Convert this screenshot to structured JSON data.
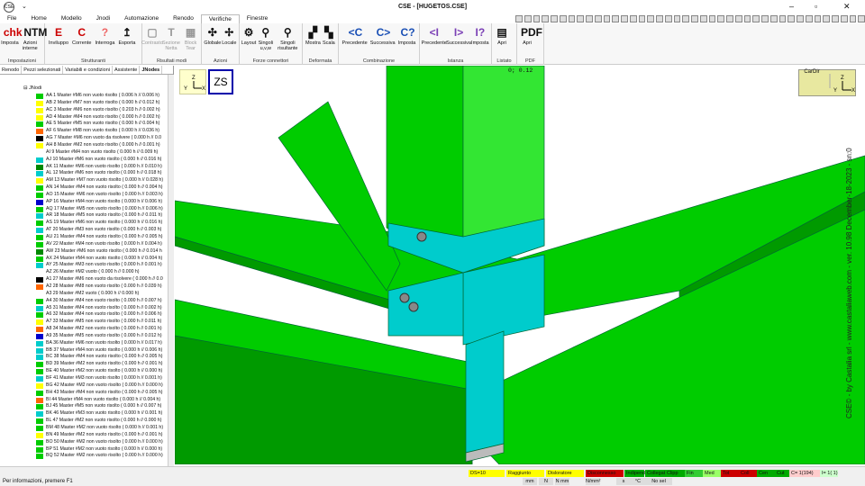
{
  "title": "CSE - [HUGETOS.CSE]",
  "quick_access_label": "⌄",
  "menu": {
    "tabs": [
      "File",
      "Home",
      "Modello",
      "Jnodi",
      "Automazione",
      "Renodo",
      "Verifiche",
      "Finestre"
    ],
    "active": "Verifiche"
  },
  "ribbon": {
    "groups": [
      {
        "label": "Impostazioni",
        "buttons": [
          {
            "label": "Imposta",
            "icon": "chk"
          },
          {
            "label": "Azioni\ninterne",
            "icon": "NTM"
          }
        ]
      },
      {
        "label": "Strutturanti",
        "buttons": [
          {
            "label": "Inviluppo",
            "icon": "E"
          },
          {
            "label": "Corrente",
            "icon": "C"
          },
          {
            "label": "Interroga",
            "icon": "?"
          },
          {
            "label": "Esporta",
            "icon": "↥"
          }
        ]
      },
      {
        "label": "Risultati modi",
        "buttons": [
          {
            "label": "Contrasto",
            "icon": "▢"
          },
          {
            "label": "Sezione\nNetta",
            "icon": "T"
          },
          {
            "label": "Block\nTear",
            "icon": "▦"
          }
        ]
      },
      {
        "label": "Azioni",
        "buttons": [
          {
            "label": "Globale",
            "icon": "✣"
          },
          {
            "label": "Locale",
            "icon": "✢"
          }
        ]
      },
      {
        "label": "Forze connettori",
        "buttons": [
          {
            "label": "Layout",
            "icon": "⚙"
          },
          {
            "label": "Singoli\nu,v,w",
            "icon": "⚲"
          },
          {
            "label": "Singoli\nrisultante",
            "icon": "⚲"
          }
        ]
      },
      {
        "label": "Deformata",
        "buttons": [
          {
            "label": "Mostra",
            "icon": "▞"
          },
          {
            "label": "Scala",
            "icon": "▚"
          }
        ]
      },
      {
        "label": "Combinazione",
        "buttons": [
          {
            "label": "Precedente",
            "icon": "<C"
          },
          {
            "label": "Successiva",
            "icon": "C>"
          },
          {
            "label": "Imposta",
            "icon": "C?"
          }
        ]
      },
      {
        "label": "Istanza",
        "buttons": [
          {
            "label": "Precedente",
            "icon": "<I"
          },
          {
            "label": "Successiva",
            "icon": "I>"
          },
          {
            "label": "Imposta",
            "icon": "I?"
          }
        ]
      },
      {
        "label": "Listato",
        "buttons": [
          {
            "label": "Apri",
            "icon": "▤"
          }
        ]
      },
      {
        "label": "PDF",
        "buttons": [
          {
            "label": "Apri",
            "icon": "PDF"
          }
        ]
      }
    ]
  },
  "panel": {
    "tabs": [
      "Renodo",
      "Pezzi selezionati",
      "Variabili e condizioni",
      "Assistente",
      "JNodes"
    ],
    "active_tab": "JNodes",
    "root": "JNodi",
    "rows": [
      {
        "text": "AA 1  Master  #M6 non vuoto risolto ( 0.006 h //  0.006 h)",
        "color": "#00cc00"
      },
      {
        "text": "AB 2  Master  #M7 non vuoto risolto ( 0.000 h //  0.012 h)",
        "color": "#ffff00"
      },
      {
        "text": "AC 3  Master  #M6 non vuoto risolto ( 0.203 h //  0.002 h)",
        "color": "#ffff00"
      },
      {
        "text": "AD 4  Master  #M4 non vuoto risolto ( 0.000 h //  0.002 h)",
        "color": "#ffff00"
      },
      {
        "text": "AE 5  Master  #M5 non vuoto risolto ( 0.000 h //  0.004 h)",
        "color": "#00cc00"
      },
      {
        "text": "AF 6  Master  #M8 non vuoto risolto ( 0.000 h //  0.036 h)",
        "color": "#ff6600"
      },
      {
        "text": "AG 7  Master  #M6 non vuoto da risolvere ( 0.000 h //  0.0",
        "color": "#000000"
      },
      {
        "text": "AH 8  Master  #M2 non vuoto risolto ( 0.000 h //  0.001 h)",
        "color": "#ffff00"
      },
      {
        "text": "AI 9  Master  #M4 non vuoto risolto ( 0.000 h //  0.009 h)",
        "color": "#ffffff"
      },
      {
        "text": "AJ 10  Master  #M6 non vuoto risolto ( 0.000 h //  0.016 h)",
        "color": "#00cccc"
      },
      {
        "text": "AK 11  Master  #M6 non vuoto risolto ( 0.000 h //  0.010 h)",
        "color": "#008800"
      },
      {
        "text": "AL 12  Master  #M6 non vuoto risolto ( 0.000 h //  0.018 h)",
        "color": "#00cccc"
      },
      {
        "text": "AM 13  Master  #M7 non vuoto risolto ( 0.000 h //  0.028 h)",
        "color": "#ffff00"
      },
      {
        "text": "AN 14  Master  #M4 non vuoto risolto ( 0.000 h //  0.004 h)",
        "color": "#00cc00"
      },
      {
        "text": "AO 15  Master  #M6 non vuoto risolto ( 0.000 h //  0.003 h)",
        "color": "#00cc00"
      },
      {
        "text": "AP 16  Master  #M4 non vuoto risolto ( 0.000 h //  0.006 h)",
        "color": "#0000cc"
      },
      {
        "text": "AQ 17  Master  #M5 non vuoto risolto ( 0.000 h //  0.006 h)",
        "color": "#00cc00"
      },
      {
        "text": "AR 18  Master  #M5 non vuoto risolto ( 0.000 h //  0.011 h)",
        "color": "#00cccc"
      },
      {
        "text": "AS 19  Master  #M6 non vuoto risolto ( 0.000 h //  0.016 h)",
        "color": "#00cc00"
      },
      {
        "text": "AT 20  Master  #M3 non vuoto risolto ( 0.000 h //  0.003 h)",
        "color": "#00cccc"
      },
      {
        "text": "AU 21  Master  #M4 non vuoto risolto ( 0.000 h //  0.005 h)",
        "color": "#00cc00"
      },
      {
        "text": "AV 22  Master  #M4 non vuoto risolto ( 0.000 h //  0.004 h)",
        "color": "#00cc00"
      },
      {
        "text": "AW 23  Master  #M6 non vuoto risolto ( 0.000 h //  0.014 h",
        "color": "#008800"
      },
      {
        "text": "AX 24  Master  #M4 non vuoto risolto ( 0.000 h //  0.004 h)",
        "color": "#00cc00"
      },
      {
        "text": "AY 25  Master  #M3 non vuoto risolto ( 0.000 h //  0.001 h)",
        "color": "#00cccc"
      },
      {
        "text": "AZ 26  Master  #M2 vuoto ( 0.000 h //  0.000 h)",
        "color": "#ffffff"
      },
      {
        "text": "A1 27  Master  #M6 non vuoto da risolvere ( 0.000 h //  0.0",
        "color": "#000000"
      },
      {
        "text": "A2 28  Master  #M8 non vuoto risolto ( 0.000 h //  0.039 h)",
        "color": "#ff6600"
      },
      {
        "text": "A3 29  Master  #M2 vuoto ( 0.000 h //  0.000 h)",
        "color": "#ffffff"
      },
      {
        "text": "A4 30  Master  #M4 non vuoto risolto ( 0.000 h //  0.007 h)",
        "color": "#00cc00"
      },
      {
        "text": "A5 31  Master  #M4 non vuoto risolto ( 0.000 h //  0.002 h)",
        "color": "#00cccc"
      },
      {
        "text": "A6 32  Master  #M4 non vuoto risolto ( 0.000 h //  0.006 h)",
        "color": "#00cc00"
      },
      {
        "text": "A7 33  Master  #M5 non vuoto risolto ( 0.000 h //  0.011 h)",
        "color": "#ffff00"
      },
      {
        "text": "A8 34  Master  #M2 non vuoto risolto ( 0.000 h //  0.001 h)",
        "color": "#ff6600"
      },
      {
        "text": "A9 35  Master  #M5 non vuoto risolto ( 0.000 h //  0.012 h)",
        "color": "#0000cc"
      },
      {
        "text": "BA 36  Master  #M6 non vuoto risolto ( 0.000 h //  0.017 h)",
        "color": "#00cccc"
      },
      {
        "text": "BB 37  Master  #M4 non vuoto risolto ( 0.000 h //  0.006 h)",
        "color": "#00cccc"
      },
      {
        "text": "BC 38  Master  #M4 non vuoto risolto ( 0.000 h //  0.005 h)",
        "color": "#00cccc"
      },
      {
        "text": "BD 39  Master  #M2 non vuoto risolto ( 0.000 h //  0.001 h)",
        "color": "#00cc00"
      },
      {
        "text": "BE 40  Master  #M2 non vuoto risolto ( 0.000 h //  0.000 h)",
        "color": "#00cc00"
      },
      {
        "text": "BF 41  Master  #M3 non vuoto risolto ( 0.000 h //  0.001 h)",
        "color": "#00cccc"
      },
      {
        "text": "BG 42  Master  #M2 non vuoto risolto ( 0.000 h //  0.000 h)",
        "color": "#ffff00"
      },
      {
        "text": "BH 43  Master  #M4 non vuoto risolto ( 0.000 h //  0.005 h)",
        "color": "#00cc00"
      },
      {
        "text": "BI 44  Master  #M4 non vuoto risolto ( 0.000 h //  0.004 h)",
        "color": "#ff6600"
      },
      {
        "text": "BJ 45  Master  #M5 non vuoto risolto ( 0.000 h //  0.007 h)",
        "color": "#00cc00"
      },
      {
        "text": "BK 46  Master  #M3 non vuoto risolto ( 0.000 h //  0.001 h)",
        "color": "#00cccc"
      },
      {
        "text": "BL 47  Master  #M2 non vuoto risolto ( 0.000 h //  0.000 h)",
        "color": "#00cc00"
      },
      {
        "text": "BM 48  Master  #M2 non vuoto risolto ( 0.000 h //  0.001 h)",
        "color": "#00cc00"
      },
      {
        "text": "BN 49  Master  #M2 non vuoto risolto ( 0.000 h //  0.001 h)",
        "color": "#ffff00"
      },
      {
        "text": "BO 50  Master  #M2 non vuoto risolto ( 0.000 h //  0.000 h)",
        "color": "#00cc00"
      },
      {
        "text": "BP 51  Master  #M2 non vuoto risolto ( 0.000 h //  0.000 h)",
        "color": "#00cc00"
      },
      {
        "text": "BQ 52  Master  #M2 non vuoto risolto ( 0.000 h //  0.000 h)",
        "color": "#00cc00"
      }
    ]
  },
  "view": {
    "coords": "0; 0.12",
    "zs_label": "ZS",
    "cardir_label": "CarDir",
    "watermark": "CSE© - by Castalia srl - www.castaliaweb.com - ver. 10.98 December-18-2023 - sn:0",
    "bg_color": "#00cc00"
  },
  "status": {
    "left_text": "Per informazioni, premere F1",
    "boxes": [
      {
        "label": "DS=10",
        "color": "#ffff00"
      },
      {
        "label": "Raggiunto",
        "color": "#ffff00"
      },
      {
        "label": "Disloratore",
        "color": "#ffff00"
      },
      {
        "label": "Disconnesso",
        "color": "#cc0000"
      },
      {
        "label": "Indipend.",
        "color": "#00aa00"
      },
      {
        "label": "Collegato",
        "color": "#00aa00"
      },
      {
        "label": "Clipp",
        "color": "#00aa00"
      },
      {
        "label": "Fin",
        "color": "#33cc33"
      },
      {
        "label": "Med",
        "color": "#99ff66"
      },
      {
        "label": "Tot",
        "color": "#cc0000"
      },
      {
        "label": "Coll",
        "color": "#cc0000"
      },
      {
        "label": "Cen",
        "color": "#00aa00"
      },
      {
        "label": "Cut",
        "color": "#00aa00"
      },
      {
        "label": "C= 1(194)",
        "color": "#ffcccc"
      },
      {
        "label": "I= 1( 1)",
        "color": "#ccffcc"
      }
    ],
    "units": [
      "mm",
      "N",
      "N mm",
      "N/mm²",
      "s",
      "°C",
      "No sel"
    ]
  }
}
